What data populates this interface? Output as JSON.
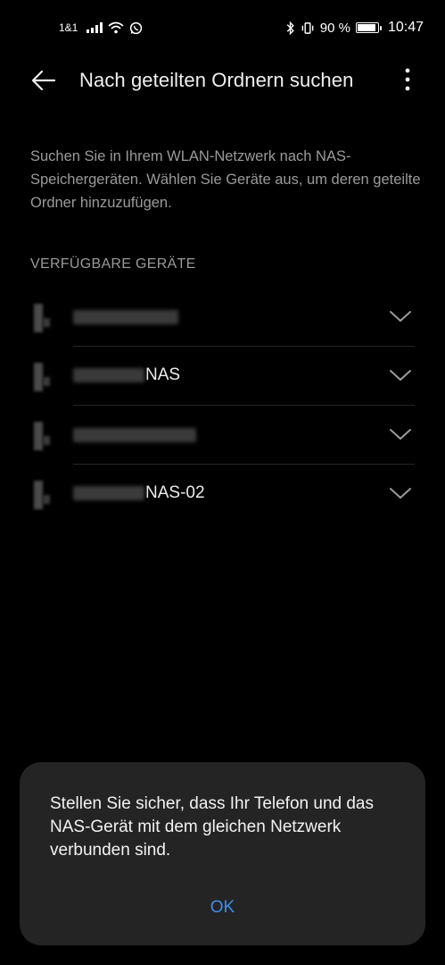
{
  "status_bar": {
    "carrier": "1&1",
    "battery_percent": "90 %",
    "battery_level": 0.9,
    "time": "10:47",
    "icons": [
      "signal-icon",
      "wifi-icon",
      "whatsapp-icon",
      "bluetooth-icon",
      "vibrate-icon",
      "battery-icon"
    ]
  },
  "app_bar": {
    "title": "Nach geteilten Ordnern suchen",
    "back_icon": "back-arrow-icon",
    "more_icon": "more-vert-icon"
  },
  "intro_text": "Suchen Sie in Ihrem WLAN-Netzwerk nach NAS-Speichergeräten. Wählen Sie Geräte aus, um deren geteilte Ordner hinzuzufügen.",
  "section_header": "VERFÜGBARE GERÄTE",
  "devices": [
    {
      "name_suffix": ""
    },
    {
      "name_suffix": "NAS"
    },
    {
      "name_suffix": ""
    },
    {
      "name_suffix": "NAS-02"
    }
  ],
  "dialog": {
    "message": "Stellen Sie sicher, dass Ihr Telefon und das NAS-Gerät mit dem gleichen Netzwerk verbunden sind.",
    "ok_label": "OK"
  },
  "colors": {
    "background": "#000000",
    "dialog_bg": "#242424",
    "accent": "#3f8ee8",
    "secondary_text": "#9a9a9a"
  }
}
